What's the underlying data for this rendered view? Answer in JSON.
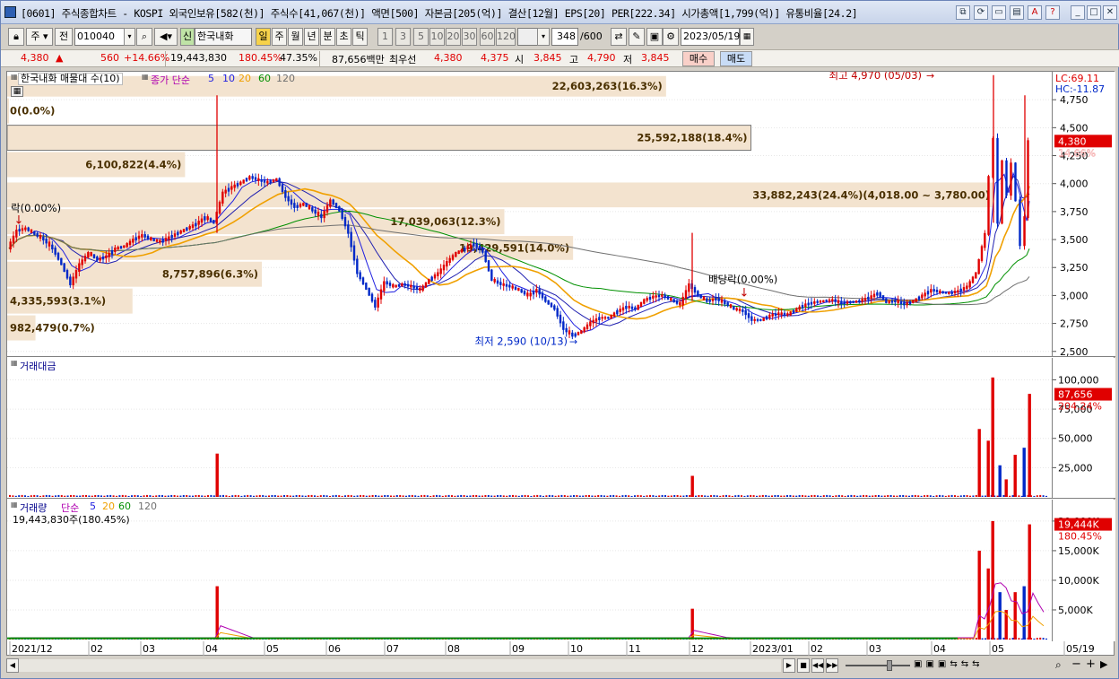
{
  "window": {
    "title": "[0601] 주식종합차트 - KOSPI 외국인보유[582(천)] 주식수[41,067(천)] 액면[500] 자본금[205(억)] 결산[12월] EPS[20] PER[222.34] 시가총액[1,799(억)] 유통비율[24.2]"
  },
  "toolbar": {
    "type_value": "주",
    "type_all": "전",
    "code": "010040",
    "stock_name": "한국내화",
    "new_badge": "신",
    "periods": [
      "일",
      "주",
      "월",
      "년",
      "분",
      "초",
      "틱"
    ],
    "active_period": "일",
    "intervals": [
      "1",
      "3",
      "5",
      "10",
      "20",
      "30",
      "60",
      "120"
    ],
    "count": "348",
    "count_max": "/600",
    "date": "2023/05/19"
  },
  "pricebar": {
    "price": "4,380",
    "arrow": "▲",
    "change": "560",
    "change_pct": "+14.66%",
    "volume": "19,443,830",
    "vol_ratio": "180.45%",
    "strength": "47.35%",
    "trade_amount": "87,656백만",
    "pref_label": "최우선",
    "ask": "4,380",
    "bid": "4,375",
    "open_label": "시",
    "open": "3,845",
    "high_label": "고",
    "high": "4,790",
    "low_label": "저",
    "low": "3,845",
    "buy_label": "매수",
    "sell_label": "매도"
  },
  "price_panel": {
    "title": "한국내화 매물대 수(10)",
    "ma_label": "종가 단순",
    "ma_periods": [
      "5",
      "10",
      "20",
      "60",
      "120"
    ],
    "lc": "LC:69.11",
    "hc": "HC:-11.87",
    "high_annot": "최고 4,970 (05/03)",
    "low_annot": "최저 2,590 (10/13)",
    "ex_div_left": "락(0.00%)",
    "ex_div_mid": "배당락(0.00%)",
    "price_ticks": [
      "4,750",
      "4,500",
      "4,250",
      "4,000",
      "3,750",
      "3,500",
      "3,250",
      "3,000",
      "2,750",
      "2,500"
    ],
    "cur_price": "4,380",
    "cur_pct": "14.66%",
    "volume_profile": [
      {
        "label": "22,603,263(16.3%)",
        "range": [
          4770,
          4970
        ],
        "pct": 16.3
      },
      {
        "label": "0(0.0%)",
        "range": [
          4530,
          4770
        ],
        "pct": 0.0
      },
      {
        "label": "25,592,188(18.4%)",
        "range": [
          4290,
          4530
        ],
        "pct": 18.4
      },
      {
        "label": "6,100,822(4.4%)",
        "range": [
          4050,
          4290
        ],
        "pct": 4.4
      },
      {
        "label": "33,882,243(24.4%)(4,018.00 ~ 3,780.00)",
        "range": [
          3780,
          4018
        ],
        "pct": 24.4
      },
      {
        "label": "17,039,063(12.3%)",
        "range": [
          3540,
          3780
        ],
        "pct": 12.3
      },
      {
        "label": "19,429,591(14.0%)",
        "range": [
          3310,
          3540
        ],
        "pct": 14.0
      },
      {
        "label": "8,757,896(6.3%)",
        "range": [
          3070,
          3310
        ],
        "pct": 6.3
      },
      {
        "label": "4,335,593(3.1%)",
        "range": [
          2830,
          3070
        ],
        "pct": 3.1
      },
      {
        "label": "982,479(0.7%)",
        "range": [
          2590,
          2830
        ],
        "pct": 0.7
      }
    ]
  },
  "amount_panel": {
    "title": "거래대금",
    "ticks": [
      "100,000",
      "75,000",
      "50,000",
      "25,000"
    ],
    "cur_value": "87,656",
    "cur_pct": "204.24%"
  },
  "volume_panel": {
    "title": "거래량",
    "ma_label": "단순",
    "ma_periods": [
      "5",
      "20",
      "60",
      "120"
    ],
    "info": "19,443,830주(180.45%)",
    "ticks": [
      "20,000K",
      "15,000K",
      "10,000K",
      "5,000K"
    ],
    "cur_value": "19,444K",
    "cur_pct": "180.45%"
  },
  "x_axis": {
    "labels": [
      "2021/12",
      "02",
      "03",
      "04",
      "05",
      "06",
      "07",
      "08",
      "09",
      "10",
      "11",
      "12",
      "2023/01",
      "02",
      "03",
      "04",
      "05",
      "05/19"
    ]
  },
  "colors": {
    "up": "#e00000",
    "down": "#0028c8",
    "ma5": "#2020e0",
    "ma10": "#2020e0",
    "ma20": "#f0a000",
    "ma60": "#009000",
    "ma120": "#707070",
    "profile": "#f3e3cf"
  },
  "chart_data": {
    "type": "candlestick",
    "title": "한국내화",
    "ylim": [
      2450,
      5000
    ],
    "x_range": [
      "2021/12",
      "2023/05/19"
    ],
    "price_path": [
      [
        0,
        3420
      ],
      [
        10,
        3580
      ],
      [
        20,
        3600
      ],
      [
        30,
        3550
      ],
      [
        40,
        3500
      ],
      [
        50,
        3420
      ],
      [
        60,
        3280
      ],
      [
        70,
        3100
      ],
      [
        80,
        3280
      ],
      [
        90,
        3380
      ],
      [
        100,
        3320
      ],
      [
        110,
        3350
      ],
      [
        120,
        3420
      ],
      [
        130,
        3440
      ],
      [
        140,
        3500
      ],
      [
        150,
        3540
      ],
      [
        160,
        3500
      ],
      [
        170,
        3480
      ],
      [
        180,
        3520
      ],
      [
        190,
        3560
      ],
      [
        200,
        3600
      ],
      [
        210,
        3640
      ],
      [
        220,
        3700
      ],
      [
        230,
        3650
      ],
      [
        240,
        3920
      ],
      [
        250,
        3970
      ],
      [
        260,
        4010
      ],
      [
        270,
        4060
      ],
      [
        280,
        4030
      ],
      [
        290,
        4010
      ],
      [
        300,
        4040
      ],
      [
        310,
        3880
      ],
      [
        320,
        3790
      ],
      [
        330,
        3820
      ],
      [
        340,
        3760
      ],
      [
        350,
        3700
      ],
      [
        360,
        3850
      ],
      [
        370,
        3760
      ],
      [
        380,
        3560
      ],
      [
        390,
        3200
      ],
      [
        400,
        3060
      ],
      [
        410,
        2900
      ],
      [
        420,
        3120
      ],
      [
        430,
        3080
      ],
      [
        440,
        3100
      ],
      [
        450,
        3080
      ],
      [
        460,
        3050
      ],
      [
        470,
        3140
      ],
      [
        480,
        3200
      ],
      [
        490,
        3300
      ],
      [
        500,
        3380
      ],
      [
        510,
        3420
      ],
      [
        520,
        3460
      ],
      [
        530,
        3390
      ],
      [
        540,
        3140
      ],
      [
        550,
        3100
      ],
      [
        560,
        3080
      ],
      [
        570,
        3050
      ],
      [
        580,
        3000
      ],
      [
        590,
        3050
      ],
      [
        600,
        2950
      ],
      [
        610,
        2880
      ],
      [
        620,
        2700
      ],
      [
        630,
        2640
      ],
      [
        640,
        2680
      ],
      [
        650,
        2760
      ],
      [
        660,
        2800
      ],
      [
        670,
        2800
      ],
      [
        680,
        2860
      ],
      [
        690,
        2900
      ],
      [
        700,
        2880
      ],
      [
        710,
        2960
      ],
      [
        720,
        2990
      ],
      [
        730,
        3000
      ],
      [
        740,
        2960
      ],
      [
        750,
        2920
      ],
      [
        760,
        3100
      ],
      [
        770,
        3000
      ],
      [
        780,
        2950
      ],
      [
        790,
        2970
      ],
      [
        800,
        2930
      ],
      [
        810,
        2880
      ],
      [
        820,
        2860
      ],
      [
        830,
        2780
      ],
      [
        840,
        2780
      ],
      [
        850,
        2820
      ],
      [
        860,
        2840
      ],
      [
        870,
        2830
      ],
      [
        880,
        2880
      ],
      [
        890,
        2920
      ],
      [
        900,
        2940
      ],
      [
        910,
        2950
      ],
      [
        920,
        2960
      ],
      [
        930,
        2930
      ],
      [
        940,
        2940
      ],
      [
        950,
        2950
      ],
      [
        960,
        2980
      ],
      [
        970,
        3020
      ],
      [
        980,
        2940
      ],
      [
        990,
        2950
      ],
      [
        1000,
        2920
      ],
      [
        1010,
        2950
      ],
      [
        1020,
        3000
      ],
      [
        1030,
        3050
      ],
      [
        1040,
        3030
      ],
      [
        1050,
        3020
      ],
      [
        1060,
        3040
      ],
      [
        1070,
        3080
      ],
      [
        1080,
        3200
      ],
      [
        1090,
        3550
      ],
      [
        1095,
        4060
      ],
      [
        1100,
        4400
      ],
      [
        1105,
        3650
      ],
      [
        1110,
        4200
      ],
      [
        1115,
        3900
      ],
      [
        1120,
        4180
      ],
      [
        1125,
        3850
      ],
      [
        1130,
        3450
      ],
      [
        1135,
        3700
      ],
      [
        1138,
        4380
      ]
    ],
    "amount_spikes": [
      [
        232,
        37000
      ],
      [
        762,
        18000
      ],
      [
        1082,
        58000
      ],
      [
        1092,
        48000
      ],
      [
        1097,
        102000
      ],
      [
        1105,
        27000
      ],
      [
        1112,
        15000
      ],
      [
        1122,
        36000
      ],
      [
        1132,
        42000
      ],
      [
        1138,
        88000
      ]
    ],
    "volume_spikes": [
      [
        232,
        9000
      ],
      [
        762,
        5200
      ],
      [
        1082,
        15000
      ],
      [
        1092,
        12000
      ],
      [
        1097,
        20000
      ],
      [
        1105,
        8000
      ],
      [
        1112,
        5000
      ],
      [
        1122,
        8000
      ],
      [
        1132,
        9000
      ],
      [
        1138,
        19444
      ]
    ]
  }
}
